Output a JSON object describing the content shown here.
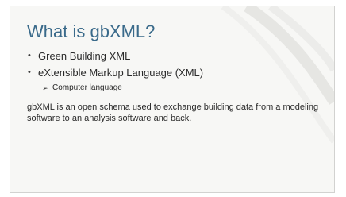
{
  "slide": {
    "title": "What is gbXML?",
    "bullets": [
      {
        "text": "Green Building XML"
      },
      {
        "text": "eXtensible Markup Language (XML)"
      }
    ],
    "sub_bullets": [
      {
        "text": "Computer language"
      }
    ],
    "paragraph": "gbXML is an open schema used to exchange building data from a modeling software to an analysis software and back."
  },
  "icons": {
    "bullet": "bullet-dot-icon",
    "sub_bullet": "arrow-bullet-icon"
  },
  "colors": {
    "title": "#3a6a8a",
    "background": "#f7f7f5",
    "text": "#2a2a2a"
  }
}
